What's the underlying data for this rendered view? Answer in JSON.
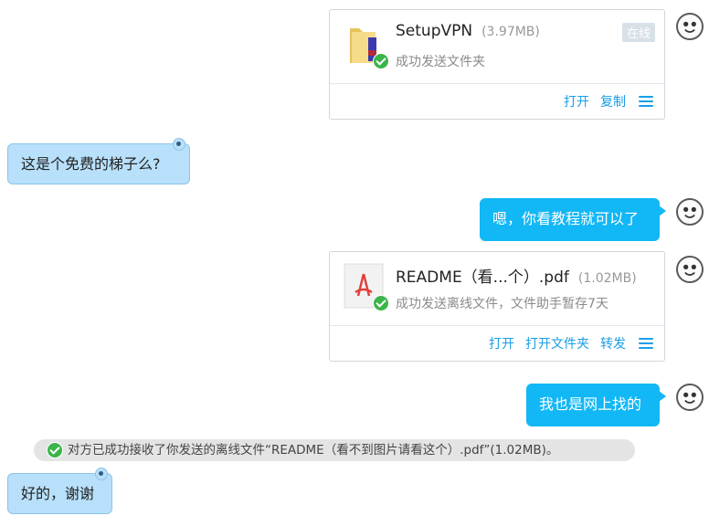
{
  "messages": {
    "file1": {
      "name": "SetupVPN",
      "size": "(3.97MB)",
      "badge": "在线",
      "status": "成功发送文件夹",
      "actions": [
        "打开",
        "复制"
      ],
      "icon": "folder-icon"
    },
    "left1": {
      "text": "这是个免费的梯子么?"
    },
    "right1": {
      "text": "嗯，你看教程就可以了"
    },
    "file2": {
      "name": "README（看...个）.pdf",
      "size": "(1.02MB)",
      "status": "成功发送离线文件，文件助手暂存7天",
      "actions": [
        "打开",
        "打开文件夹",
        "转发"
      ],
      "icon": "pdf-icon"
    },
    "right2": {
      "text": "我也是网上找的"
    },
    "system": {
      "text": "对方已成功接收了你发送的离线文件“README（看不到图片请看这个）.pdf”(1.02MB)。"
    },
    "left2": {
      "text": "好的，谢谢"
    }
  },
  "colors": {
    "accent": "#1a9ee6",
    "sent_bubble": "#12b7f5",
    "received_bubble": "#b8e0fb",
    "success": "#3ab54a"
  }
}
